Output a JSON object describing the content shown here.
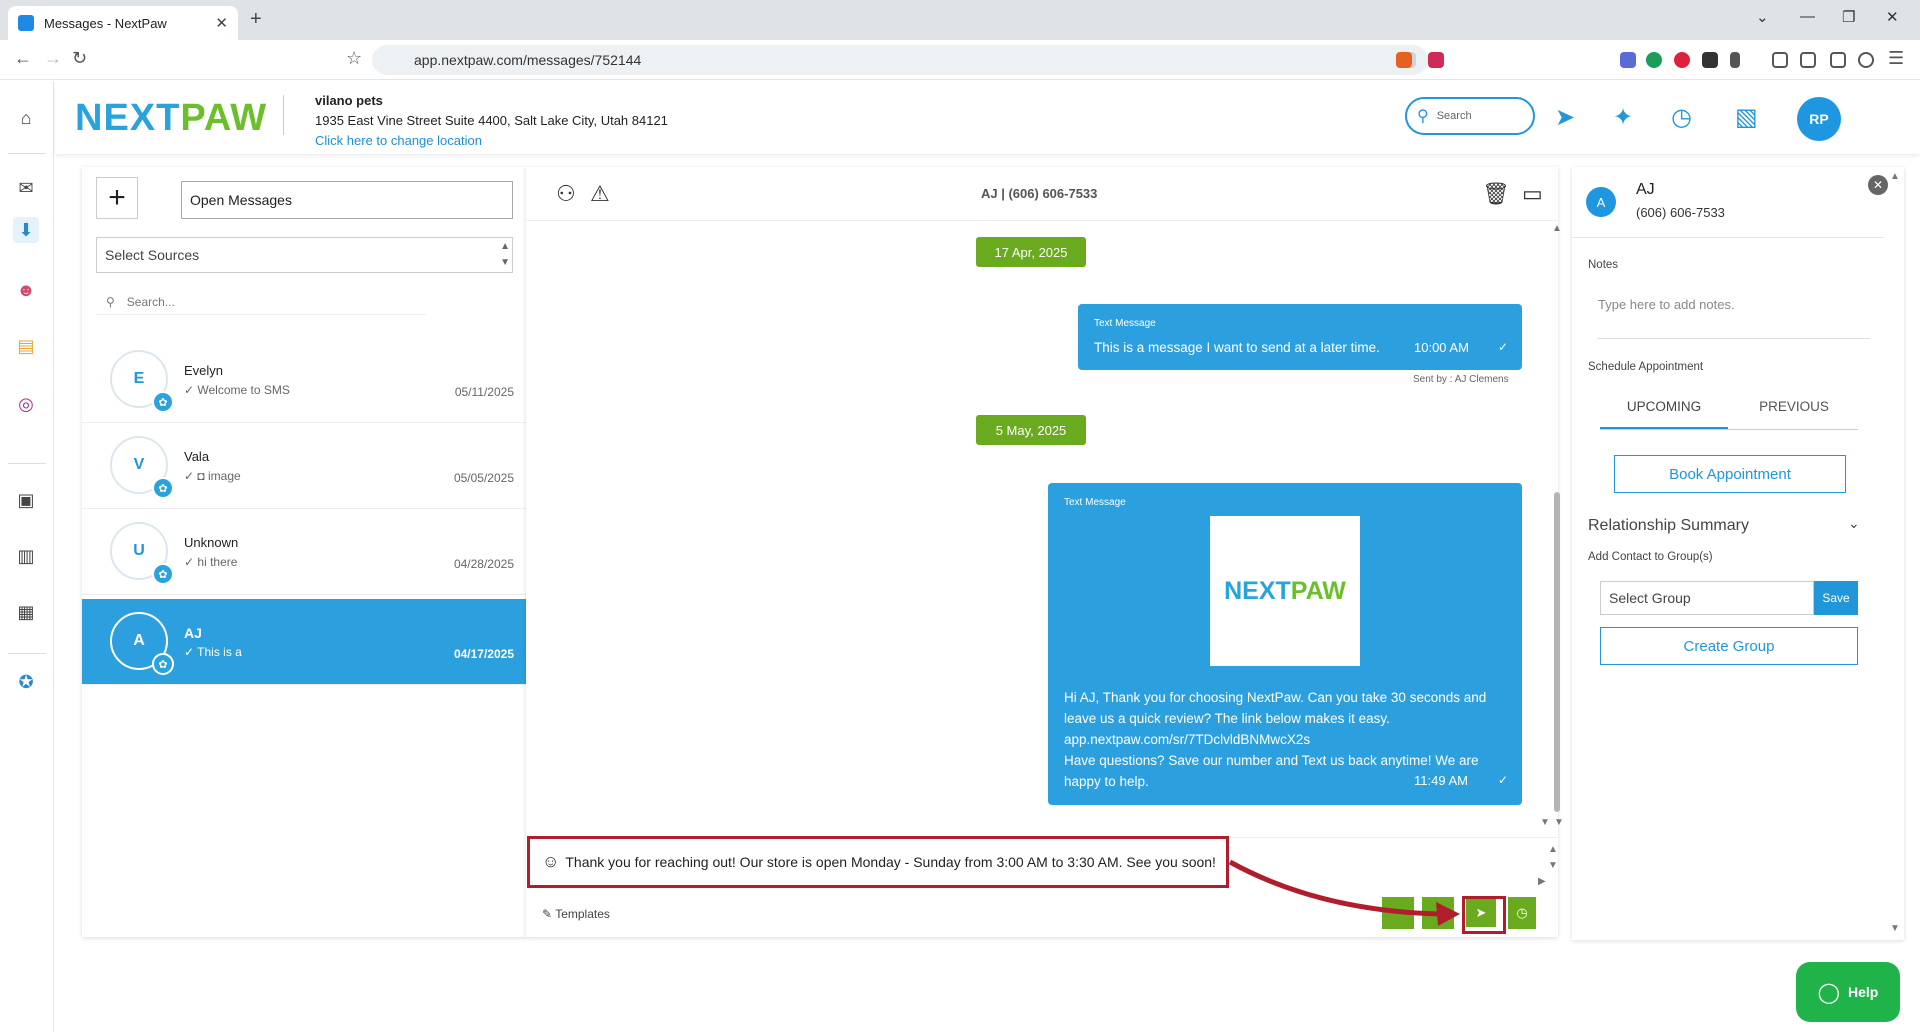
{
  "browser": {
    "tab_title": "Messages - NextPaw",
    "url": "app.nextpaw.com/messages/752144"
  },
  "header": {
    "logo_next": "NEXT",
    "logo_paw": "PAW",
    "location_name": "vilano pets",
    "location_address": "1935 East Vine Street Suite 4400, Salt Lake City, Utah 84121",
    "change_location": "Click here to change location",
    "search_placeholder": "Search",
    "user_initials": "RP"
  },
  "list": {
    "filter": "Open Messages",
    "sources_placeholder": "Select Sources",
    "search_placeholder": "Search...",
    "conversations": [
      {
        "initial": "E",
        "name": "Evelyn",
        "preview": "Welcome to SMS",
        "date": "05/11/2025"
      },
      {
        "initial": "V",
        "name": "Vala",
        "preview": "image",
        "date": "05/05/2025"
      },
      {
        "initial": "U",
        "name": "Unknown",
        "preview": "hi there",
        "date": "04/28/2025"
      },
      {
        "initial": "A",
        "name": "AJ",
        "preview": "This is a",
        "date": "04/17/2025"
      }
    ]
  },
  "chat": {
    "title": "AJ | (606) 606-7533",
    "date1": "17 Apr, 2025",
    "msg1": {
      "label": "Text Message",
      "text": "This is a message I want to send at a later time.",
      "time": "10:00 AM",
      "sent_by": "Sent by : AJ Clemens"
    },
    "date2": "5 May, 2025",
    "msg2": {
      "label": "Text Message",
      "image_next": "NEXT",
      "image_paw": "PAW",
      "line1": "Hi AJ, Thank you for choosing NextPaw. Can you take 30 seconds and",
      "line2": "leave us a quick review? The link below makes it easy.",
      "line3": "app.nextpaw.com/sr/7TDclvldBNMwcX2s",
      "line4": "Have questions? Save our number and Text us back anytime! We are",
      "line5": "happy to help.",
      "time": "11:49 AM"
    },
    "composer_text": "Thank you for reaching out! Our store is open Monday - Sunday from 3:00 AM to 3:30 AM. See you soon!",
    "templates_label": "Templates"
  },
  "contact": {
    "initial": "A",
    "name": "AJ",
    "phone": "(606) 606-7533",
    "notes_label": "Notes",
    "notes_placeholder": "Type here to add notes.",
    "schedule_label": "Schedule Appointment",
    "tab_upcoming": "UPCOMING",
    "tab_previous": "PREVIOUS",
    "book_button": "Book Appointment",
    "relationship_summary": "Relationship Summary",
    "add_contact_label": "Add Contact to Group(s)",
    "group_placeholder": "Select Group",
    "save_button": "Save",
    "create_group_button": "Create Group"
  },
  "help_label": "Help",
  "colors": {
    "brand_blue": "#2c9fdf",
    "brand_green": "#6aaa1e",
    "annotation_red": "#b01e2e"
  }
}
